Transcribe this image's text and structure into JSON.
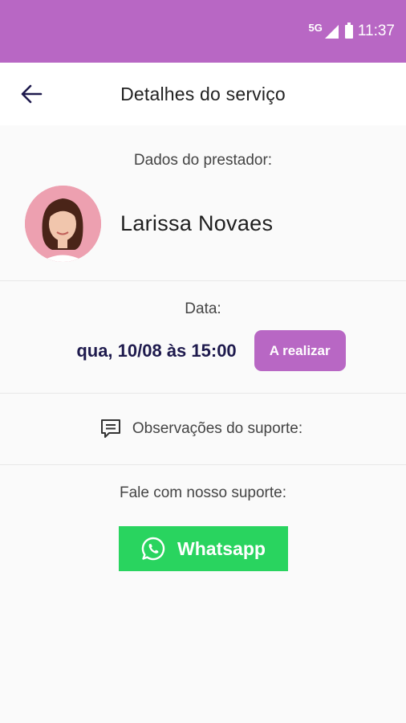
{
  "status_bar": {
    "network": "5G",
    "time": "11:37"
  },
  "app_bar": {
    "title": "Detalhes do serviço"
  },
  "provider": {
    "label": "Dados do prestador:",
    "name": "Larissa Novaes"
  },
  "schedule": {
    "label": "Data:",
    "value": "qua, 10/08 às 15:00",
    "status": "A realizar"
  },
  "observations": {
    "label": "Observações do suporte:"
  },
  "support": {
    "label": "Fale com nosso suporte:",
    "button_label": "Whatsapp"
  },
  "colors": {
    "accent": "#b867c4",
    "whatsapp": "#29d45f",
    "date_text": "#1e1a4d"
  },
  "icons": {
    "back": "arrow-left-icon",
    "observations": "comment-icon",
    "whatsapp": "whatsapp-icon"
  }
}
